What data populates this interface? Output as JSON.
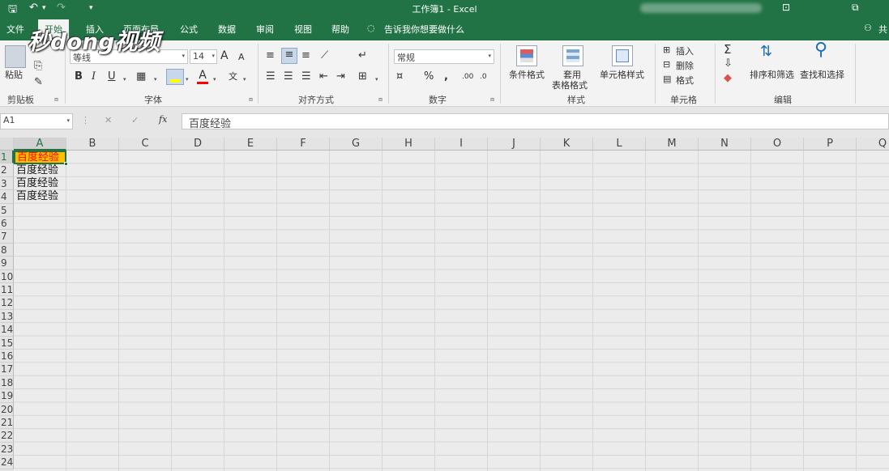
{
  "titlebar": {
    "title": "工作簿1  -  Excel",
    "save": "🖫",
    "undo": "↶",
    "undo_dd": "▾",
    "redo": "↷",
    "qat_more": "▾",
    "restore": "⧉",
    "ribbon_display": "⊡"
  },
  "menu": {
    "file": "文件",
    "home": "开始",
    "insert": "插入",
    "layout": "页面布局",
    "formulas": "公式",
    "data": "数据",
    "review": "审阅",
    "view": "视图",
    "help": "帮助",
    "tellme": "告诉我你想要做什么",
    "share": "共"
  },
  "ribbon": {
    "clipboard": {
      "paste": "粘贴",
      "label": "剪贴板"
    },
    "font": {
      "name": "等线",
      "size": "14",
      "grow": "A",
      "shrink": "A",
      "bold": "B",
      "italic": "I",
      "underline": "U",
      "label": "字体",
      "wen": "文"
    },
    "alignment": {
      "label": "对齐方式"
    },
    "number": {
      "format": "常规",
      "percent": "%",
      "comma": ",",
      "label": "数字"
    },
    "styles": {
      "conditional": "条件格式",
      "table1": "套用",
      "table2": "表格格式",
      "cell_styles": "单元格样式",
      "label": "样式"
    },
    "cells": {
      "insert": "插入",
      "delete": "删除",
      "format": "格式",
      "label": "单元格"
    },
    "editing": {
      "sum": "Σ",
      "sort": "排序和筛选",
      "find": "查找和选择",
      "label": "编辑"
    }
  },
  "formula": {
    "namebox": "A1",
    "cancel": "✕",
    "enter": "✓",
    "fx": "fx",
    "content": "百度经验"
  },
  "columns": [
    "A",
    "B",
    "C",
    "D",
    "E",
    "F",
    "G",
    "H",
    "I",
    "J",
    "K",
    "L",
    "M",
    "N",
    "O",
    "P",
    "Q"
  ],
  "rows": [
    "1",
    "2",
    "3",
    "4",
    "5",
    "6",
    "7",
    "8",
    "9",
    "10",
    "11",
    "12",
    "13",
    "14",
    "15",
    "16",
    "17",
    "18",
    "19",
    "20",
    "21",
    "22",
    "23",
    "24"
  ],
  "cells": {
    "A1": "百度经验",
    "A2": "百度经验",
    "A3": "百度经验",
    "A4": "百度经验"
  },
  "watermark": "秒dong视频",
  "colors": {
    "accent": "#217346",
    "a1_fill": "#ffc000",
    "a1_text": "#ff0000",
    "font_color": "#ff0000",
    "fill_color": "#ffff00"
  }
}
